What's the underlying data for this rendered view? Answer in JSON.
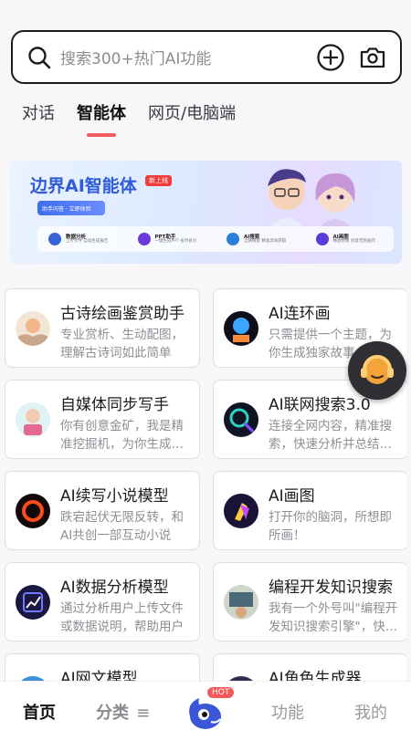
{
  "search": {
    "placeholder": "搜索300+热门AI功能",
    "icons": [
      "search-icon",
      "add-circle-icon",
      "camera-icon"
    ]
  },
  "tabs": [
    {
      "label": "对话",
      "active": false
    },
    {
      "label": "智能体",
      "active": true
    },
    {
      "label": "网页/电脑端",
      "active": false
    }
  ],
  "banner": {
    "title": "边界AI智能体",
    "badge": "新上线",
    "cta": "助手问答 · 立即体验",
    "features": [
      {
        "name": "数据分析",
        "desc": "上传文件 自动生成报告",
        "color": "#3b63d9"
      },
      {
        "name": "PPT助手",
        "desc": "一键生成PPT 省时省力",
        "color": "#6a3bd9"
      },
      {
        "name": "AI搜索",
        "desc": "全网搜索 精准高效获取",
        "color": "#2a7fd9"
      },
      {
        "name": "AI画图",
        "desc": "释放想象 创意无限画作",
        "color": "#5b3bd9"
      }
    ]
  },
  "cards": [
    {
      "title": "古诗绘画鉴赏助手",
      "desc": "专业赏析、生动配图，理解古诗词如此简单",
      "icon": "poetry-painting-icon"
    },
    {
      "title": "AI连环画",
      "desc": "只需提供一个主题，为你生成独家故事",
      "icon": "comic-icon"
    },
    {
      "title": "自媒体同步写手",
      "desc": "你有创意金矿，我是精准挖掘机，为你生成内容",
      "icon": "media-writer-icon"
    },
    {
      "title": "AI联网搜索3.0",
      "desc": "连接全网内容，精准搜索，快速分析并总结信息",
      "icon": "web-search-icon"
    },
    {
      "title": "AI续写小说模型",
      "desc": "跌宕起伏无限反转，和AI共创一部互动小说",
      "icon": "novel-icon"
    },
    {
      "title": "AI画图",
      "desc": "打开你的脑洞，所想即所画！",
      "icon": "drawing-icon"
    },
    {
      "title": "AI数据分析模型",
      "desc": "通过分析用户上传文件或数据说明，帮助用户",
      "icon": "data-analysis-icon"
    },
    {
      "title": "编程开发知识搜索",
      "desc": "我有一个外号叫\"编程开发知识搜索引擎\"，快来问我",
      "icon": "coding-icon"
    },
    {
      "title": "AI网文模型",
      "desc": "",
      "icon": "web-novel-icon"
    },
    {
      "title": "AI角色生成器",
      "desc": "",
      "icon": "character-icon"
    }
  ],
  "bottom_nav": {
    "home": "首页",
    "category": "分类",
    "category_icon": "≡",
    "hot": "HOT",
    "features": "功能",
    "mine": "我的"
  }
}
